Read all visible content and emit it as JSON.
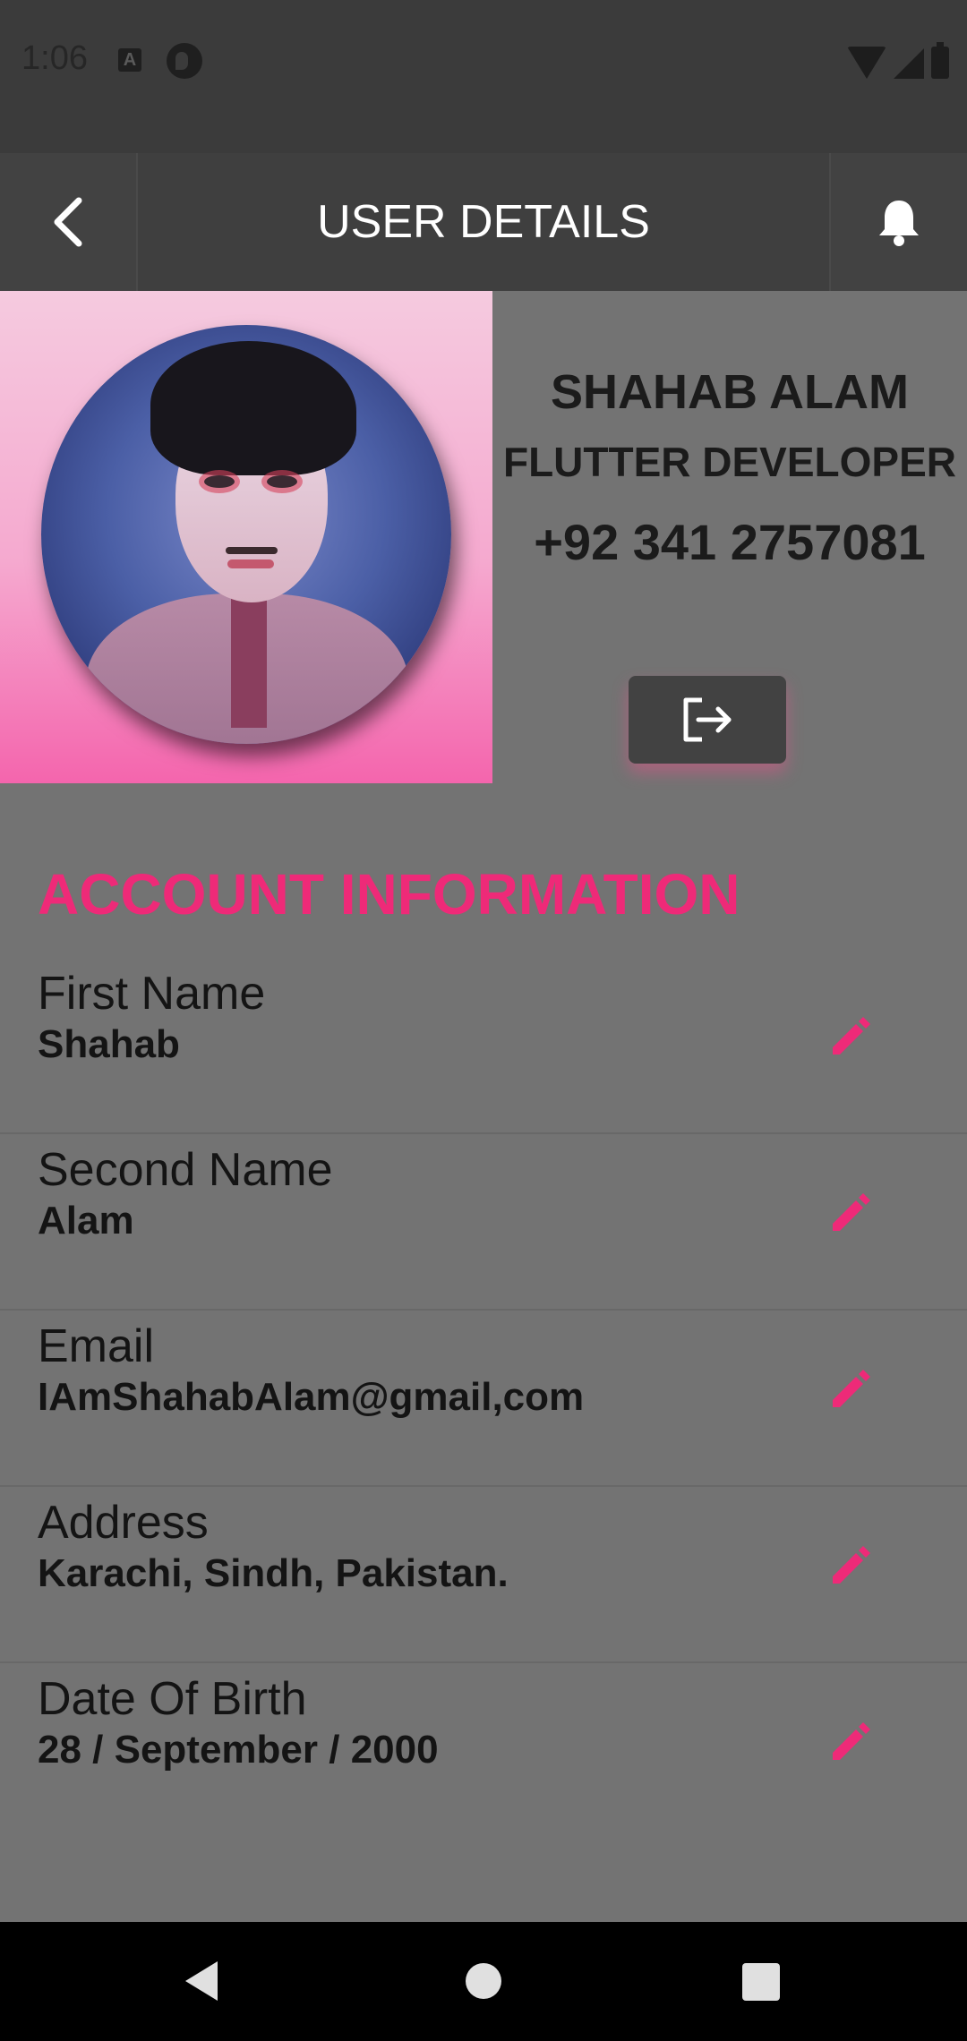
{
  "status_bar": {
    "time": "1:06",
    "notification_icons": [
      "a-icon",
      "pocket-casts-icon"
    ],
    "system_icons": [
      "wifi-icon",
      "signal-icon",
      "battery-icon"
    ]
  },
  "app_bar": {
    "title": "USER DETAILS",
    "back_icon": "chevron-left-icon",
    "notification_icon": "bell-icon"
  },
  "profile": {
    "name": "SHAHAB ALAM",
    "role": "FLUTTER DEVELOPER",
    "phone": "+92 341 2757081",
    "logout_icon": "logout-icon"
  },
  "account_information": {
    "title": "ACCOUNT INFORMATION",
    "fields": [
      {
        "label": "First Name",
        "value": "Shahab"
      },
      {
        "label": "Second Name",
        "value": "Alam"
      },
      {
        "label": "Email",
        "value": "IAmShahabAlam@gmail,com"
      },
      {
        "label": "Address",
        "value": "Karachi, Sindh, Pakistan."
      },
      {
        "label": "Date Of Birth",
        "value": "28 / September / 2000"
      }
    ],
    "edit_icon": "pencil-icon"
  },
  "colors": {
    "accent": "#ee2a78",
    "app_bar": "#3f3f3f",
    "background": "#737373"
  }
}
